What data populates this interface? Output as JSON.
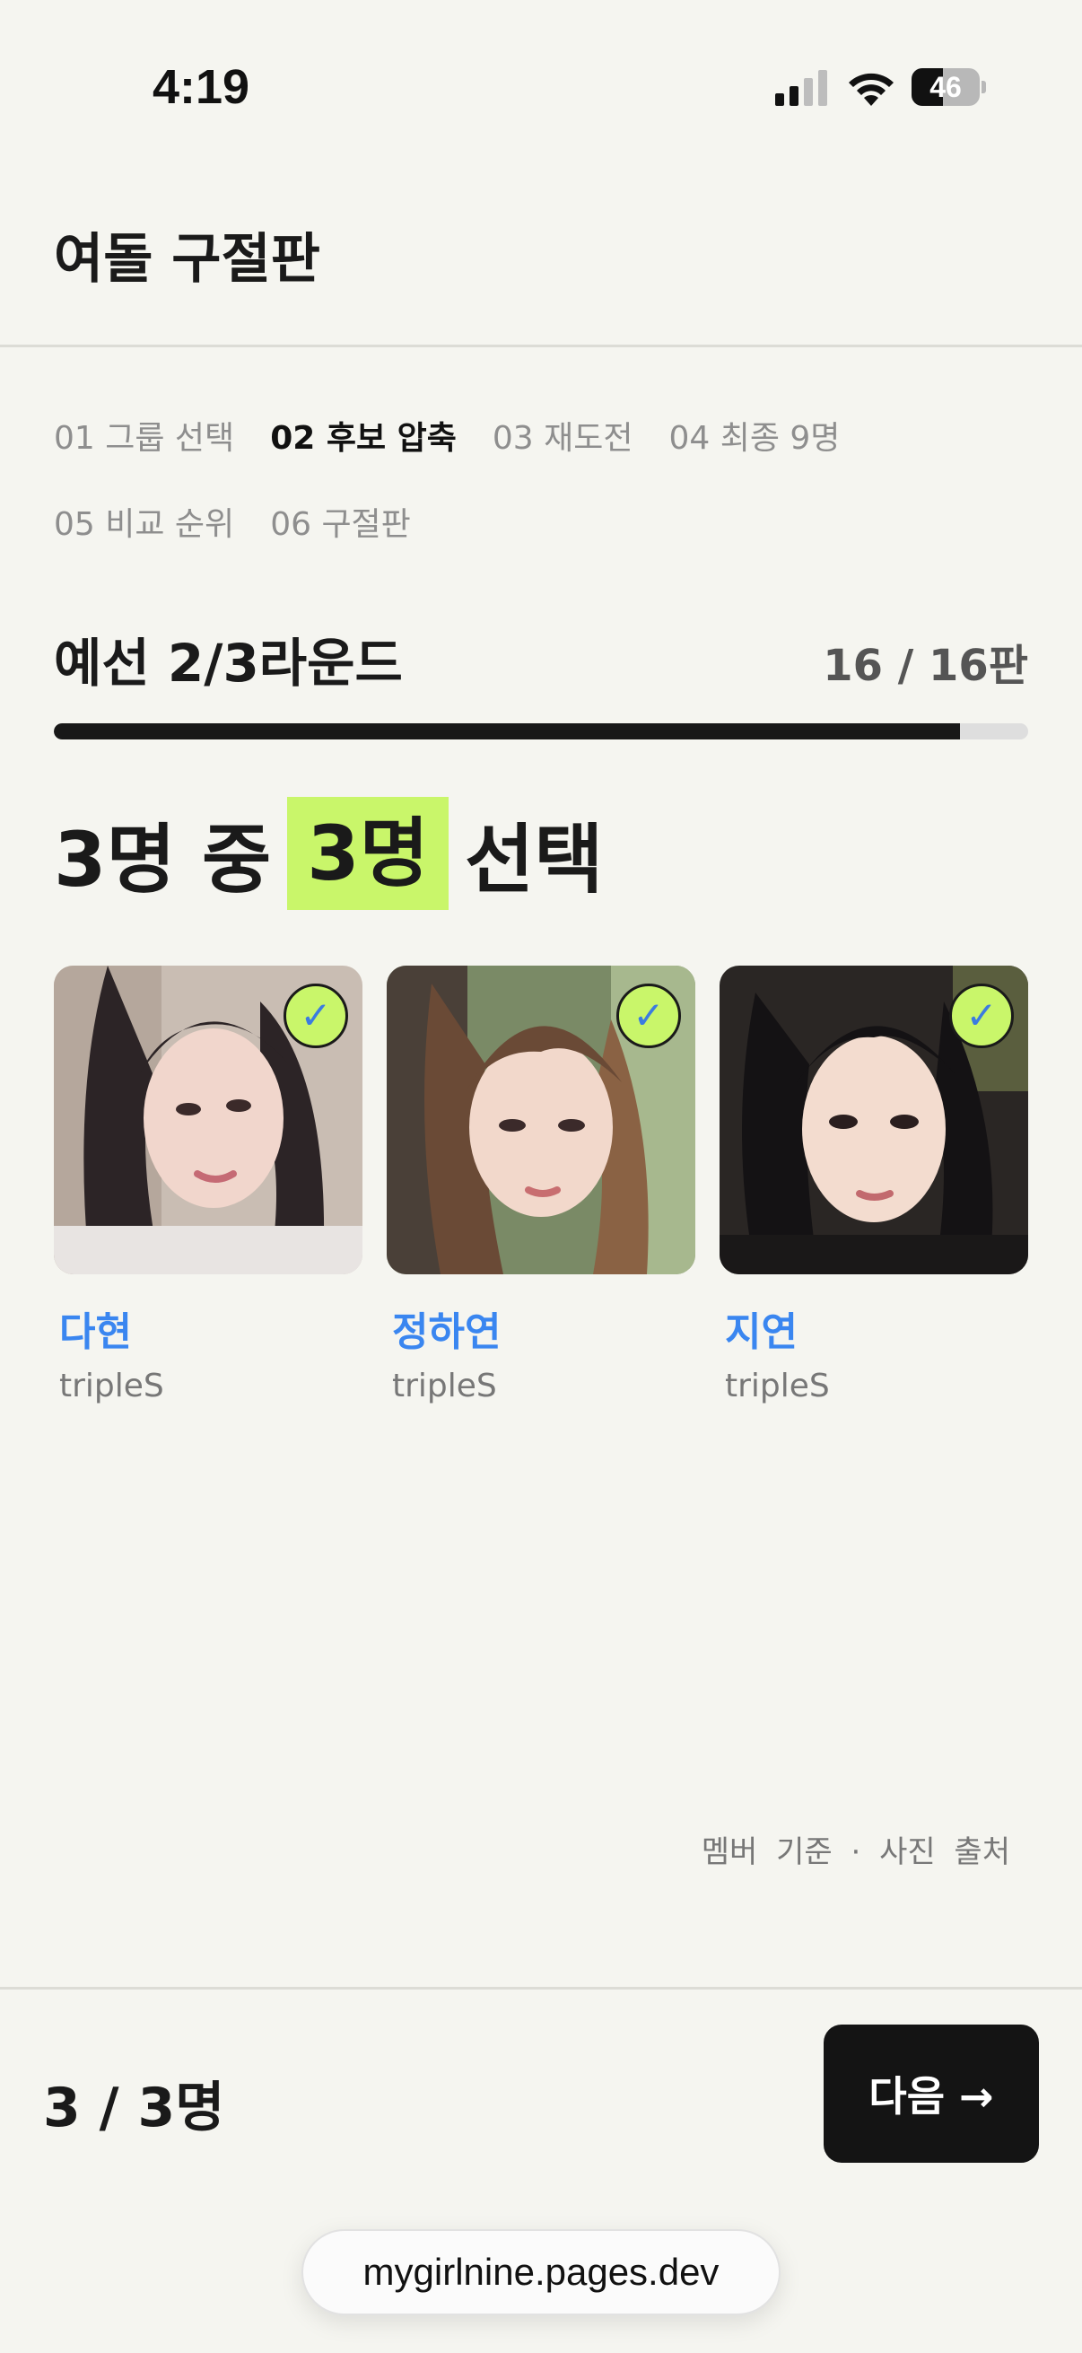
{
  "status_bar": {
    "time": "4:19",
    "battery_level": "46"
  },
  "header": {
    "title": "여돌 구절판"
  },
  "steps": [
    {
      "label": "01 그룹 선택",
      "active": false
    },
    {
      "label": "02 후보 압축",
      "active": true
    },
    {
      "label": "03 재도전",
      "active": false
    },
    {
      "label": "04 최종 9명",
      "active": false
    },
    {
      "label": "05 비교 순위",
      "active": false
    },
    {
      "label": "06 구절판",
      "active": false
    }
  ],
  "round": {
    "title": "예선 2/3라운드",
    "count": "16 / 16판",
    "progress_fraction": 0.93
  },
  "headline": {
    "prefix": "3명 중",
    "highlight": "3명",
    "suffix": "선택"
  },
  "candidates": [
    {
      "name": "다현",
      "group": "tripleS",
      "selected": true,
      "check_glyph": "✓"
    },
    {
      "name": "정하연",
      "group": "tripleS",
      "selected": true,
      "check_glyph": "✓"
    },
    {
      "name": "지연",
      "group": "tripleS",
      "selected": true,
      "check_glyph": "✓"
    }
  ],
  "source_note": "멤버 기준 · 사진 출처",
  "footer": {
    "selected_count": "3 / 3명",
    "next_label": "다음 →"
  },
  "browser": {
    "url": "mygirlnine.pages.dev"
  },
  "colors": {
    "accent_highlight": "#c9f66a",
    "name_blue": "#3a86f0",
    "background": "#f5f5f0",
    "button_dark": "#141414"
  }
}
